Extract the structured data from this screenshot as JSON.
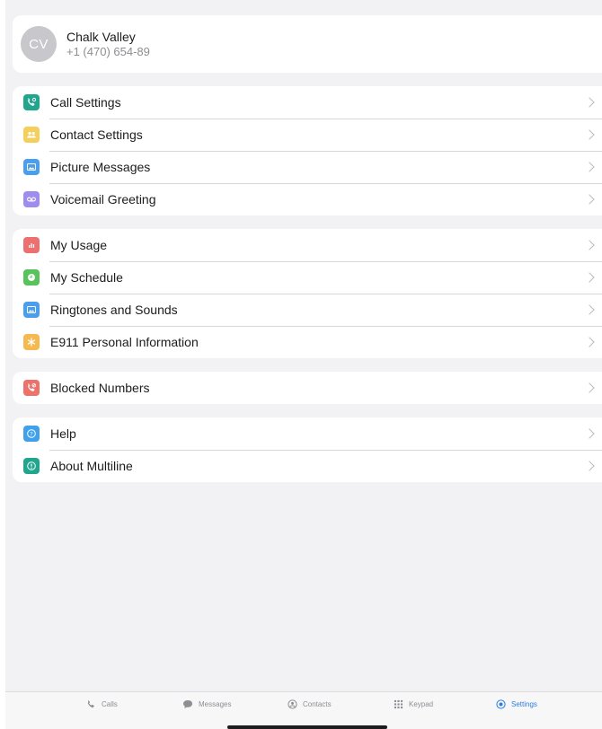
{
  "profile": {
    "initials": "CV",
    "name": "Chalk Valley",
    "phone": "+1 (470) 654-89"
  },
  "groups": [
    {
      "items": [
        {
          "label": "Call Settings",
          "icon": "phone-gear-icon",
          "color": "#1fa68d"
        },
        {
          "label": "Contact Settings",
          "icon": "people-icon",
          "color": "#f6cf5a"
        },
        {
          "label": "Picture Messages",
          "icon": "picture-icon",
          "color": "#4a9ef0"
        },
        {
          "label": "Voicemail Greeting",
          "icon": "voicemail-icon",
          "color": "#9f8cf0"
        }
      ]
    },
    {
      "items": [
        {
          "label": "My Usage",
          "icon": "bar-chart-icon",
          "color": "#ee6f6f"
        },
        {
          "label": "My Schedule",
          "icon": "clock-icon",
          "color": "#56c45b"
        },
        {
          "label": "Ringtones and Sounds",
          "icon": "picture-icon",
          "color": "#4a9ef0"
        },
        {
          "label": "E911 Personal Information",
          "icon": "asterisk-icon",
          "color": "#f5b94e"
        }
      ]
    },
    {
      "items": [
        {
          "label": "Blocked Numbers",
          "icon": "blocked-phone-icon",
          "color": "#f0706a"
        }
      ]
    },
    {
      "items": [
        {
          "label": "Help",
          "icon": "question-icon",
          "color": "#3fa0ee"
        },
        {
          "label": "About Multiline",
          "icon": "info-icon",
          "color": "#1fa68d"
        }
      ]
    }
  ],
  "tabs": [
    {
      "label": "Calls",
      "icon": "phone-icon",
      "active": false
    },
    {
      "label": "Messages",
      "icon": "chat-bubble-icon",
      "active": false
    },
    {
      "label": "Contacts",
      "icon": "person-circle-icon",
      "active": false
    },
    {
      "label": "Keypad",
      "icon": "keypad-icon",
      "active": false
    },
    {
      "label": "Settings",
      "icon": "gear-icon",
      "active": true
    }
  ],
  "colors": {
    "accent": "#2b7de9",
    "background": "#f2f2f4"
  }
}
